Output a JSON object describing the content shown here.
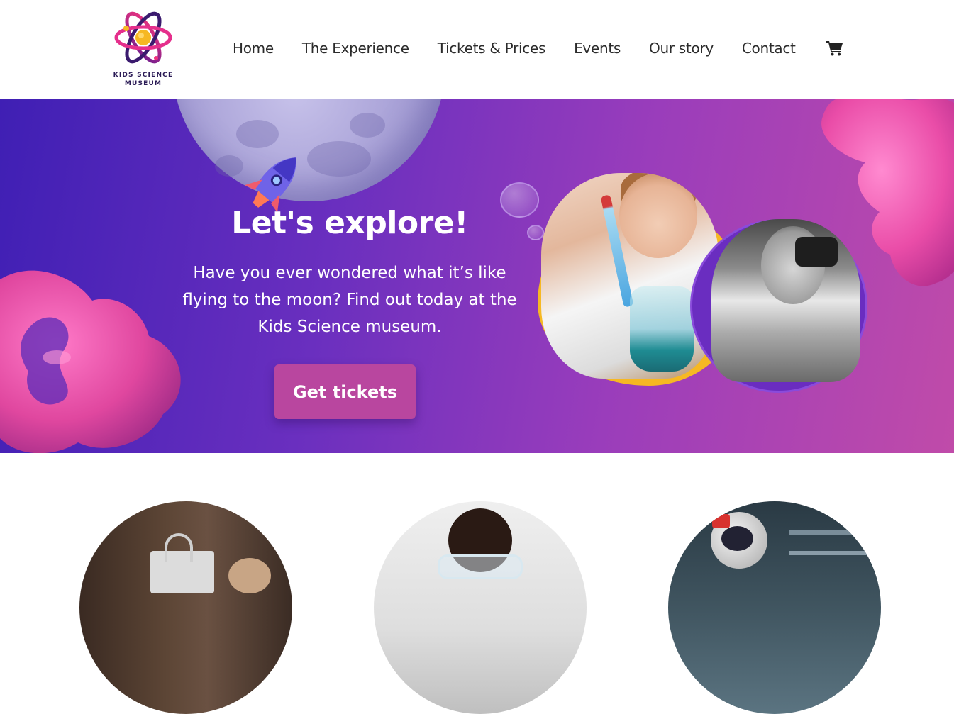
{
  "brand": {
    "name_line1": "KIDS SCIENCE",
    "name_line2": "MUSEUM",
    "colors": {
      "pink": "#e8328f",
      "purple": "#3a1a78",
      "orange": "#f6b823"
    }
  },
  "nav": {
    "items": [
      "Home",
      "The Experience",
      "Tickets & Prices",
      "Events",
      "Our story",
      "Contact"
    ],
    "cart_icon": "shopping-cart-icon"
  },
  "hero": {
    "title": "Let's explore!",
    "text": "Have you ever wondered what it’s like flying to the moon? Find out today at the Kids Science museum.",
    "cta": "Get tickets",
    "colors": {
      "gradient_start": "#3f1fb4",
      "gradient_end": "#c04ba9",
      "button": "#b9469f"
    }
  }
}
